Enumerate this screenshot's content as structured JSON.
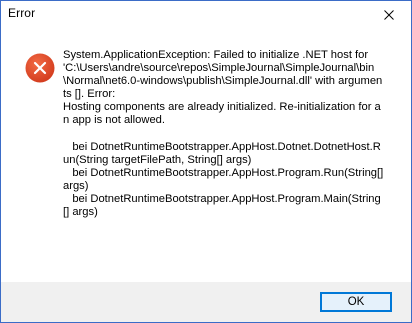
{
  "window": {
    "title": "Error"
  },
  "dialog": {
    "icon": "error-icon",
    "message": "System.ApplicationException: Failed to initialize .NET host for 'C:\\Users\\andre\\source\\repos\\SimpleJournal\\SimpleJournal\\bin\\Normal\\net6.0-windows\\publish\\SimpleJournal.dll' with arguments []. Error:\nHosting components are already initialized. Re-initialization for an app is not allowed.\n\n   bei DotnetRuntimeBootstrapper.AppHost.Dotnet.DotnetHost.Run(String targetFilePath, String[] args)\n   bei DotnetRuntimeBootstrapper.AppHost.Program.Run(String[] args)\n   bei DotnetRuntimeBootstrapper.AppHost.Program.Main(String[] args)"
  },
  "buttons": {
    "ok_label": "OK"
  },
  "colors": {
    "error_red": "#e04a2b",
    "accent_blue": "#0078d7",
    "footer_bg": "#f0f0f0"
  }
}
